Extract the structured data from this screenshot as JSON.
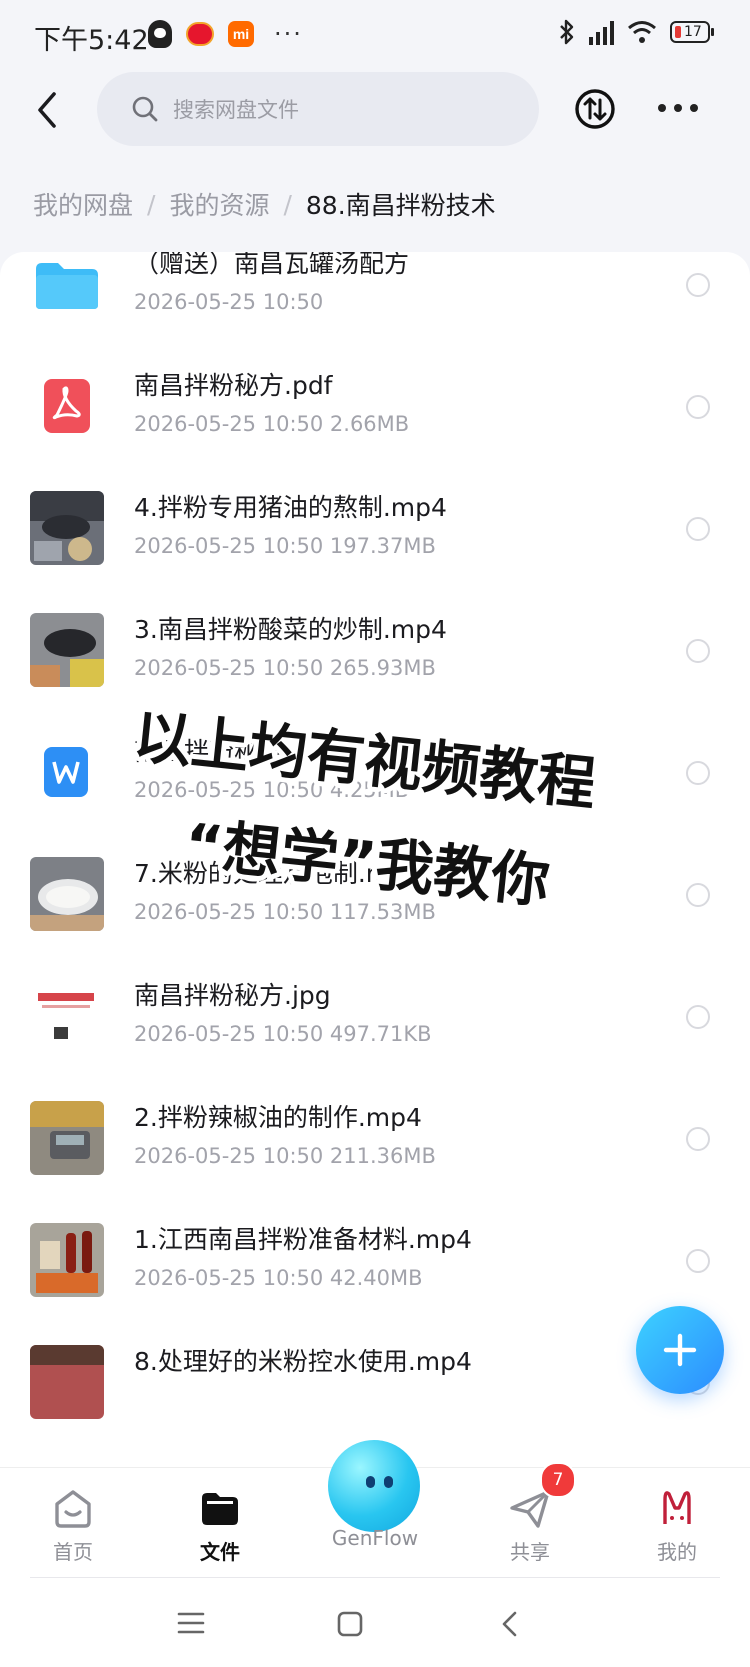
{
  "status_bar": {
    "time": "下午5:42",
    "battery": "17"
  },
  "search": {
    "placeholder": "搜索网盘文件"
  },
  "breadcrumb": {
    "items": [
      "我的网盘",
      "我的资源"
    ],
    "current": "88.南昌拌粉技术"
  },
  "files": [
    {
      "name": "（赠送）南昌瓦罐汤配方",
      "meta": "2026-05-25  10:50",
      "type": "folder"
    },
    {
      "name": "南昌拌粉秘方.pdf",
      "meta": "2026-05-25  10:50  2.66MB",
      "type": "pdf"
    },
    {
      "name": "4.拌粉专用猪油的熬制.mp4",
      "meta": "2026-05-25  10:50  197.37MB",
      "type": "video"
    },
    {
      "name": "3.南昌拌粉酸菜的炒制.mp4",
      "meta": "2026-05-25  10:50  265.93MB",
      "type": "video"
    },
    {
      "name": "南昌拌粉秘方",
      "meta": "2026-05-25  10:50  4.25MB",
      "type": "word"
    },
    {
      "name": "7.米粉的处理及泡制.mp4",
      "meta": "2026-05-25  10:50  117.53MB",
      "type": "video"
    },
    {
      "name": "南昌拌粉秘方.jpg",
      "meta": "2026-05-25  10:50  497.71KB",
      "type": "image"
    },
    {
      "name": "2.拌粉辣椒油的制作.mp4",
      "meta": "2026-05-25  10:50  211.36MB",
      "type": "video"
    },
    {
      "name": "1.江西南昌拌粉准备材料.mp4",
      "meta": "2026-05-25  10:50  42.40MB",
      "type": "video"
    },
    {
      "name": "8.处理好的米粉控水使用.mp4",
      "meta": "",
      "type": "video"
    }
  ],
  "overlay": {
    "line1": "以上均有视频教程",
    "line2": "“想学”我教你"
  },
  "tabs": {
    "home": "首页",
    "files": "文件",
    "genflow": "GenFlow",
    "share": "共享",
    "share_badge": "7",
    "mine": "我的"
  },
  "colors": {
    "accent": "#2c8cff",
    "badge": "#f03a3a",
    "pdf": "#f0505a",
    "folder": "#3ebcf7"
  }
}
